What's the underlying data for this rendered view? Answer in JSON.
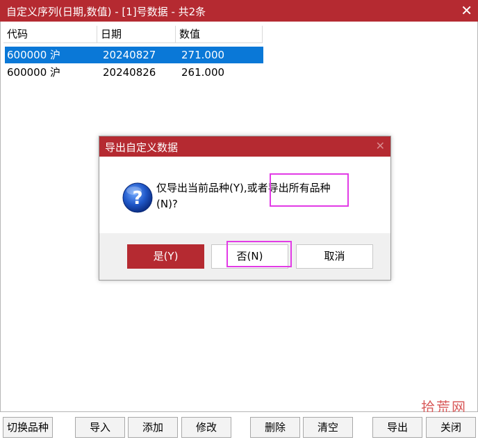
{
  "window": {
    "title": "自定义序列(日期,数值) - [1]号数据 - 共2条",
    "close_glyph": "✕"
  },
  "table": {
    "headers": [
      "代码",
      "日期",
      "数值"
    ],
    "rows": [
      {
        "code": "600000 沪",
        "date": "20240827",
        "value": "271.000",
        "selected": true
      },
      {
        "code": "600000 沪",
        "date": "20240826",
        "value": "261.000",
        "selected": false
      }
    ]
  },
  "dialog": {
    "title": "导出自定义数据",
    "close_glyph": "✕",
    "icon": "question-icon",
    "message_line1": "仅导出当前品种(Y),或者导出所有品种",
    "message_line2": "(N)?",
    "yes_label": "是(Y)",
    "no_label": "否(N)",
    "cancel_label": "取消"
  },
  "toolbar": {
    "switch_label": "切换品种",
    "import_label": "导入",
    "add_label": "添加",
    "edit_label": "修改",
    "delete_label": "删除",
    "clear_label": "清空",
    "export_label": "导出",
    "close_label": "关闭"
  },
  "watermark": "拾荒网",
  "colors": {
    "titlebar": "#b52a31",
    "selection": "#0a78d7",
    "highlight_box": "#e23be6"
  }
}
